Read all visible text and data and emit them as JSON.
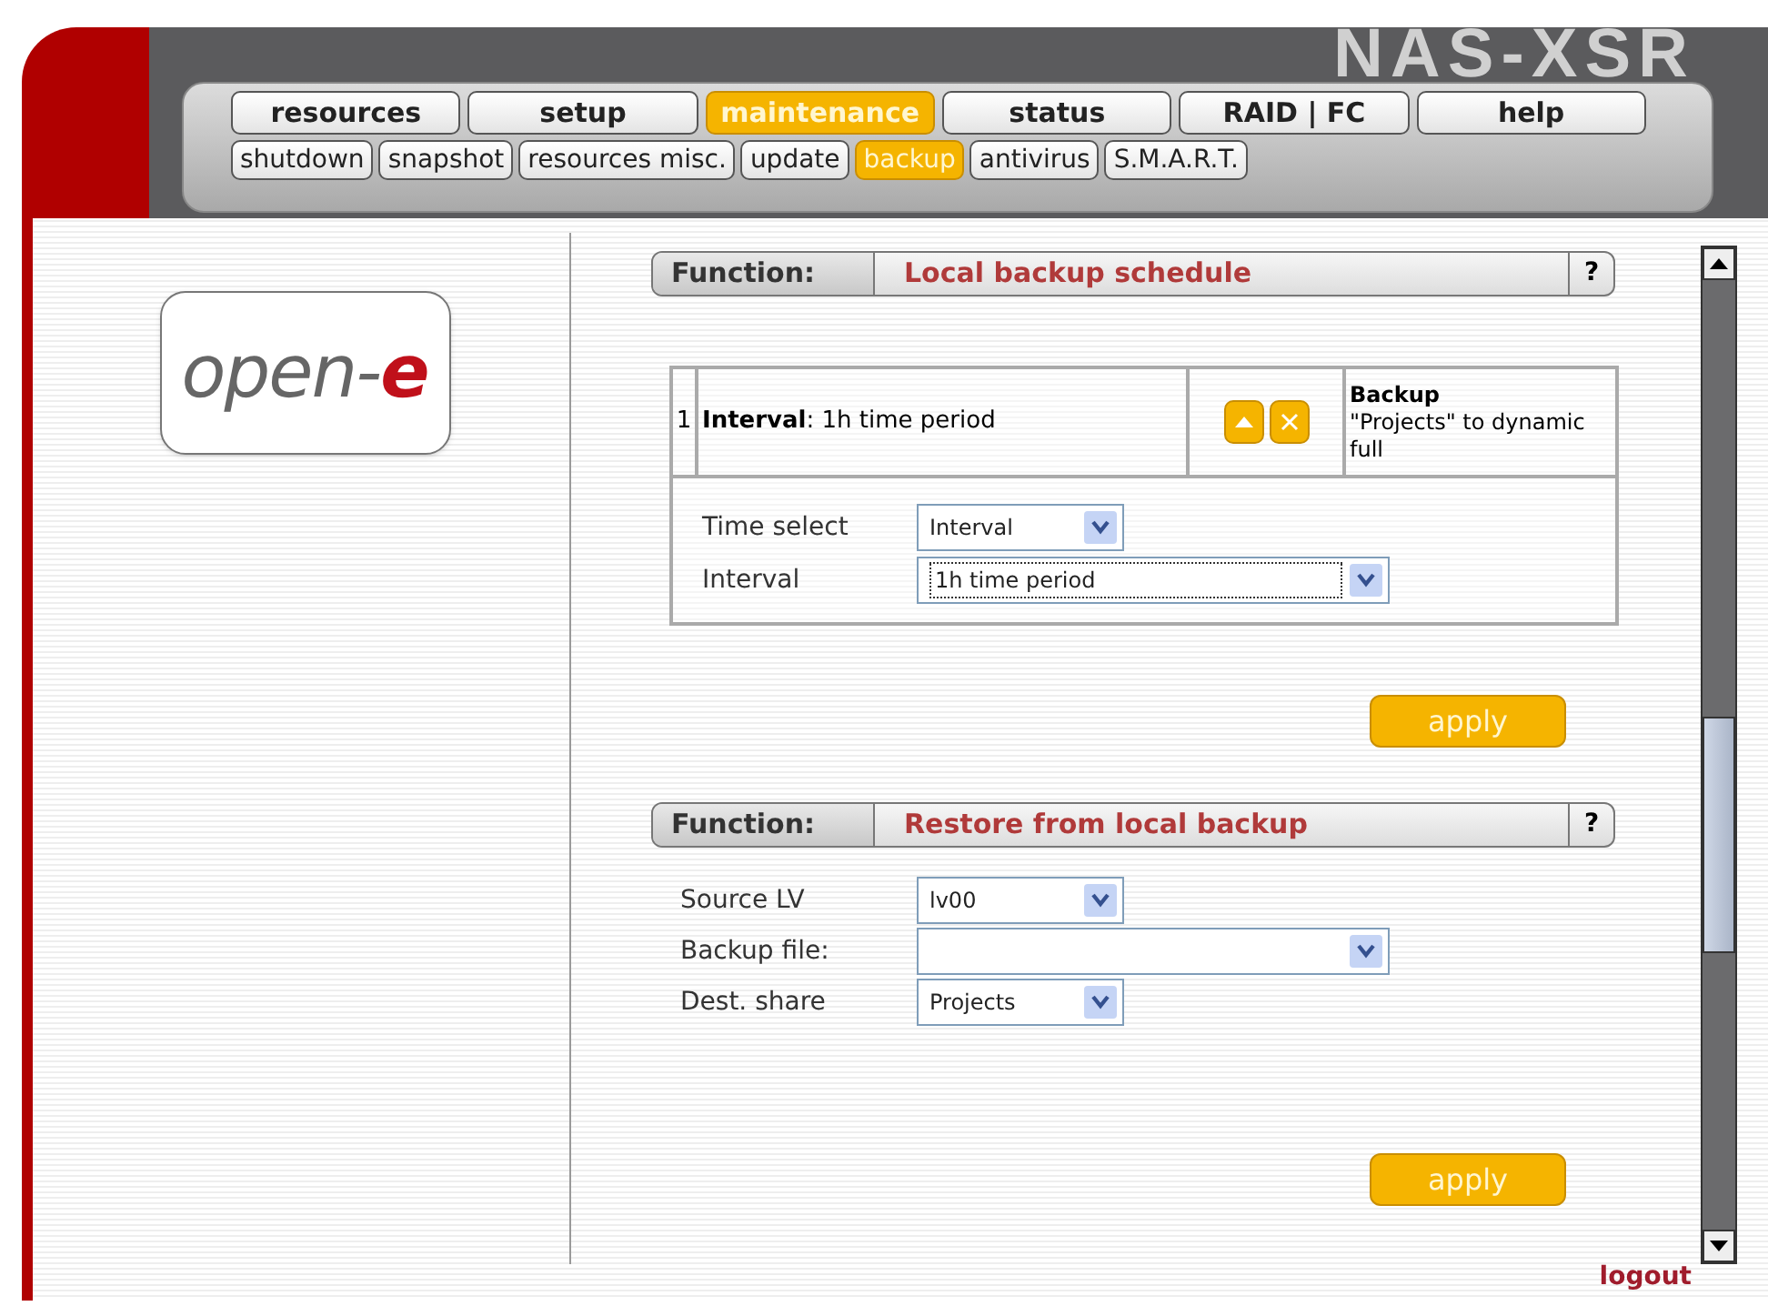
{
  "header": {
    "product_title": "NAS-XSR"
  },
  "main_tabs": [
    {
      "label": "resources",
      "selected": false
    },
    {
      "label": "setup",
      "selected": false
    },
    {
      "label": "maintenance",
      "selected": true
    },
    {
      "label": "status",
      "selected": false
    },
    {
      "label": "RAID | FC",
      "selected": false
    },
    {
      "label": "help",
      "selected": false
    }
  ],
  "sub_tabs": [
    {
      "label": "shutdown",
      "selected": false
    },
    {
      "label": "snapshot",
      "selected": false
    },
    {
      "label": "resources misc.",
      "selected": false
    },
    {
      "label": "update",
      "selected": false
    },
    {
      "label": "backup",
      "selected": true
    },
    {
      "label": "antivirus",
      "selected": false
    },
    {
      "label": "S.M.A.R.T.",
      "selected": false
    }
  ],
  "logo": {
    "text": "open-",
    "accent": "e"
  },
  "schedule_section": {
    "function_label": "Function:",
    "title": "Local backup schedule",
    "help": "?",
    "task": {
      "number": "1",
      "summary": "**Interval**: 1h time period",
      "description_title": "Backup",
      "description": "\"Projects\" to dynamic full"
    },
    "fields": [
      {
        "label": "Time select",
        "value": "Interval"
      },
      {
        "label": "Interval",
        "value": "1h time period"
      }
    ],
    "apply": "apply"
  },
  "restore_section": {
    "function_label": "Function:",
    "title": "Restore from local backup",
    "help": "?",
    "fields": [
      {
        "label": "Source LV",
        "value": "lv00"
      },
      {
        "label": "Backup file:"
      },
      {
        "label": "Dest. share",
        "value": "Projects"
      }
    ],
    "apply": "apply"
  },
  "logout": "logout"
}
